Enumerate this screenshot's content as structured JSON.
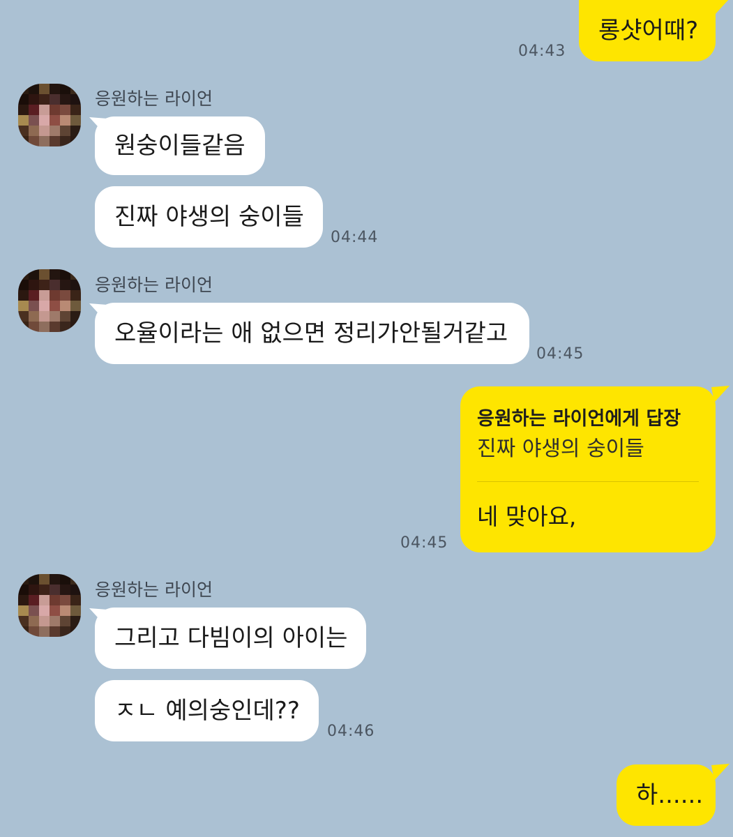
{
  "messages": [
    {
      "text": "롱샷어때?",
      "time": "04:43"
    },
    {
      "sender": "응원하는 라이언"
    },
    {
      "text": "원숭이들같음"
    },
    {
      "text": "진짜 야생의 숭이들",
      "time": "04:44"
    },
    {
      "sender": "응원하는 라이언"
    },
    {
      "text": "오율이라는 애 없으면 정리가안될거같고",
      "time": "04:45"
    },
    {
      "reply_title": "응원하는 라이언에게 답장",
      "reply_quote": "진짜 야생의 숭이들",
      "text": "네 맞아요,",
      "time": "04:45"
    },
    {
      "sender": "응원하는 라이언"
    },
    {
      "text": "그리고 다빔이의 아이는"
    },
    {
      "text": "ㅈㄴ 예의숭인데??",
      "time": "04:46"
    },
    {
      "text": "하......"
    }
  ],
  "colors": {
    "background": "#abc1d3",
    "outgoing_bubble": "#fee500",
    "incoming_bubble": "#ffffff"
  }
}
